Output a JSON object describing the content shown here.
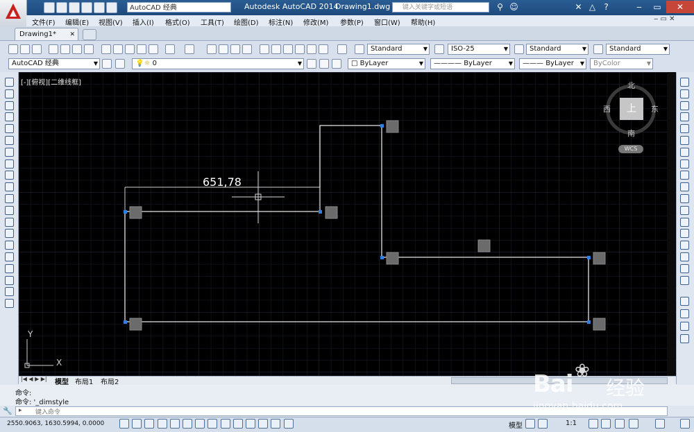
{
  "window": {
    "app_title": "Autodesk AutoCAD 2014",
    "doc_title": "Drawing1.dwg",
    "search_placeholder": "键入关键字或短语",
    "workspace_combo": "AutoCAD 经典"
  },
  "menus": [
    "文件(F)",
    "编辑(E)",
    "视图(V)",
    "插入(I)",
    "格式(O)",
    "工具(T)",
    "绘图(D)",
    "标注(N)",
    "修改(M)",
    "参数(P)",
    "窗口(W)",
    "帮助(H)"
  ],
  "tabs": {
    "drawing": "Drawing1*"
  },
  "styles": {
    "text_style": "Standard",
    "dim_style": "ISO-25",
    "table_style": "Standard",
    "mleader_style": "Standard"
  },
  "layers": {
    "workspace": "AutoCAD 经典",
    "current_layer": "0",
    "color": "ByLayer",
    "linetype": "ByLayer",
    "lineweight": "ByLayer",
    "plotstyle": "ByColor"
  },
  "viewport": {
    "label": "[-][俯视][二维线框]"
  },
  "viewcube": {
    "north": "北",
    "south": "南",
    "east": "东",
    "west": "西",
    "face": "上",
    "wcs": "WCS"
  },
  "dynamic_input": {
    "value": "651,78"
  },
  "ucs": {
    "x_label": "X",
    "y_label": "Y"
  },
  "layout_tabs": [
    "模型",
    "布局1",
    "布局2"
  ],
  "command": {
    "history": [
      "命令:",
      "命令: '_dimstyle"
    ],
    "placeholder": "键入命令"
  },
  "status": {
    "coordinates": "2550.9063, 1630.5994, 0.0000",
    "model": "模型",
    "scale": "1:1"
  },
  "watermark": {
    "brand": "Bai",
    "brand2": "经验",
    "url": "jingyan.baidu.com"
  },
  "colors": {
    "canvas": "#000000",
    "geometry": "#ffffff",
    "grip": "#2f7fe0",
    "titlebar": "#1d4a7d"
  }
}
